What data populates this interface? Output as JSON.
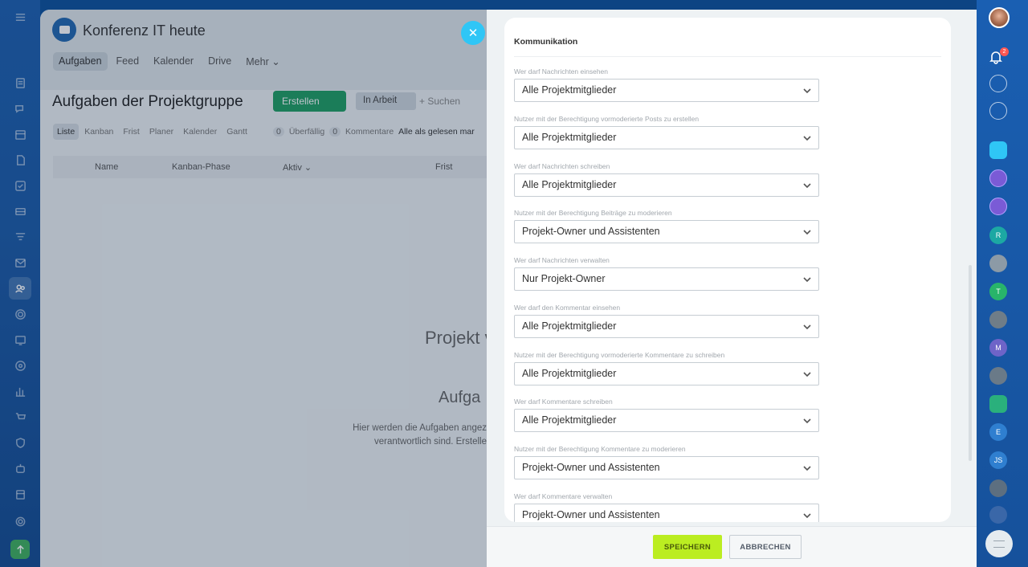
{
  "project": {
    "title": "Konferenz IT heute",
    "tabs": [
      "Aufgaben",
      "Feed",
      "Kalender",
      "Drive",
      "Mehr ⌄"
    ],
    "page_heading": "Aufgaben der Projektgruppe",
    "create_button": "Erstellen",
    "filter_chip": "In Arbeit",
    "search_placeholder": "+ Suchen",
    "view_tabs": [
      "Liste",
      "Kanban",
      "Frist",
      "Planer",
      "Kalender",
      "Gantt"
    ],
    "counter_overdue": "Überfällig",
    "counter_overdue_n": "0",
    "counter_comments": "Kommentare",
    "counter_comments_n": "0",
    "mark_all_read": "Alle als gelesen mar",
    "table_columns": [
      "Name",
      "Kanban-Phase",
      "Aktiv ⌄",
      "Frist"
    ],
    "empty_title": "Projekt v",
    "empty_sub": "Aufga",
    "empty_text_1": "Hier werden die Aufgaben angez",
    "empty_text_2": "verantwortlich sind. Erstelle"
  },
  "panel": {
    "section_title": "Kommunikation",
    "fields": [
      {
        "label": "Wer darf Nachrichten einsehen",
        "value": "Alle Projektmitglieder"
      },
      {
        "label": "Nutzer mit der Berechtigung vormoderierte Posts zu erstellen",
        "value": "Alle Projektmitglieder"
      },
      {
        "label": "Wer darf Nachrichten schreiben",
        "value": "Alle Projektmitglieder"
      },
      {
        "label": "Nutzer mit der Berechtigung Beiträge zu moderieren",
        "value": "Projekt-Owner und Assistenten"
      },
      {
        "label": "Wer darf Nachrichten verwalten",
        "value": "Nur Projekt-Owner"
      },
      {
        "label": "Wer darf den Kommentar einsehen",
        "value": "Alle Projektmitglieder"
      },
      {
        "label": "Nutzer mit der Berechtigung vormoderierte Kommentare zu schreiben",
        "value": "Alle Projektmitglieder"
      },
      {
        "label": "Wer darf Kommentare schreiben",
        "value": "Alle Projektmitglieder"
      },
      {
        "label": "Nutzer mit der Berechtigung Kommentare zu moderieren",
        "value": "Projekt-Owner und Assistenten"
      },
      {
        "label": "Wer darf Kommentare verwalten",
        "value": "Projekt-Owner und Assistenten"
      }
    ],
    "save_button": "SPEICHERN",
    "cancel_button": "ABBRECHEN"
  },
  "rail": {
    "notification_count": "2",
    "avatars": [
      "R",
      "T",
      "M",
      "E",
      "JS"
    ]
  },
  "colors": {
    "save_green": "#bbed21",
    "create_green": "#1e9e62",
    "close_blue": "#2fc6f6",
    "brand_blue": "#1a5fb2"
  }
}
